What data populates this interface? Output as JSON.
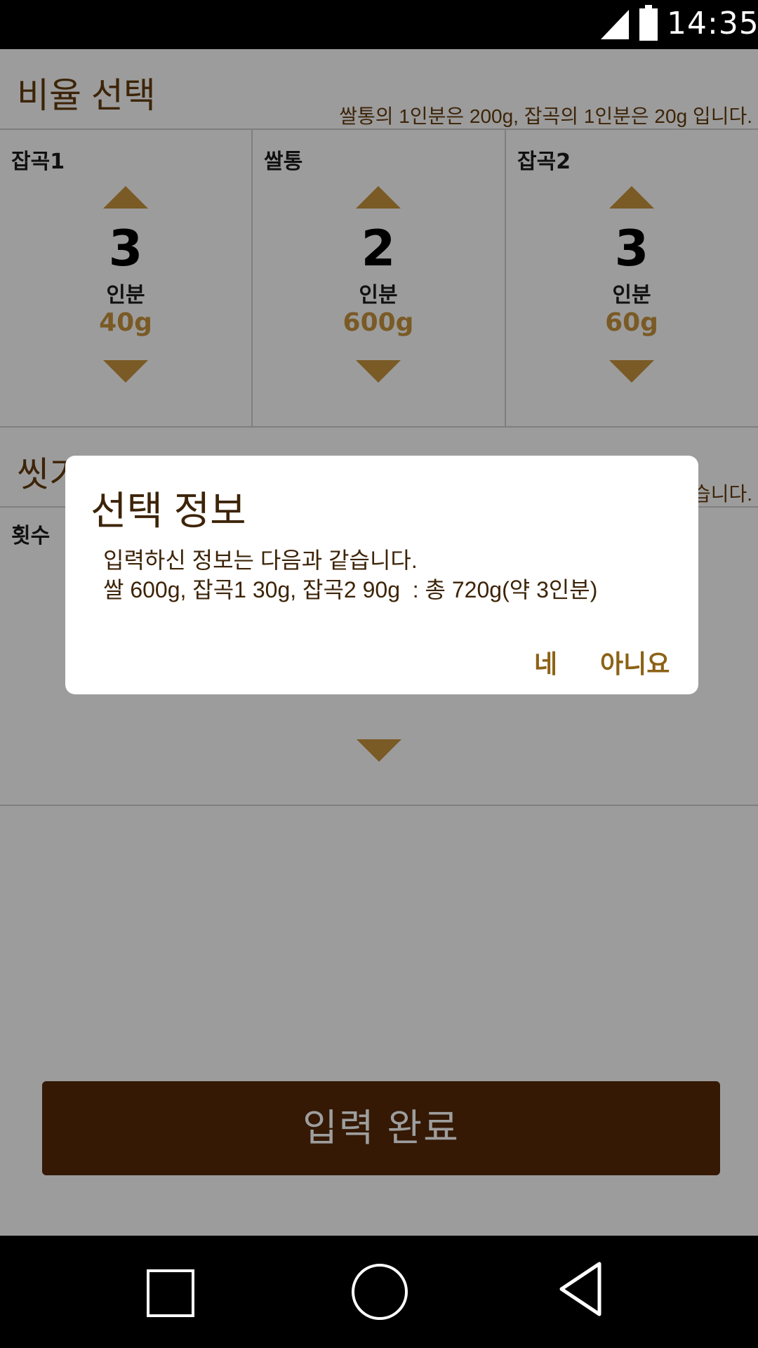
{
  "status_bar": {
    "time": "14:35",
    "signal_icon": "cell-signal-icon",
    "battery_icon": "battery-icon"
  },
  "ratio_section": {
    "title": "비율 선택",
    "note": "쌀통의 1인분은 200g, 잡곡의 1인분은 20g 입니다.",
    "columns": [
      {
        "label": "잡곡1",
        "count": "3",
        "unit": "인분",
        "grams": "40g"
      },
      {
        "label": "쌀통",
        "count": "2",
        "unit": "인분",
        "grams": "600g"
      },
      {
        "label": "잡곡2",
        "count": "3",
        "unit": "인분",
        "grams": "60g"
      }
    ]
  },
  "wash_section": {
    "title": "씻기",
    "note": "습니다.",
    "label": "횟수"
  },
  "submit_label": "입력 완료",
  "dialog": {
    "title": "선택 정보",
    "message": "입력하신 정보는 다음과 같습니다.\n쌀 600g, 잡곡1 30g, 잡곡2 90g  : 총 720g(약 3인분)",
    "yes_label": "네",
    "no_label": "아니요"
  },
  "nav_bar": {
    "recent_icon": "square-icon",
    "home_icon": "circle-icon",
    "back_icon": "back-triangle-icon"
  }
}
